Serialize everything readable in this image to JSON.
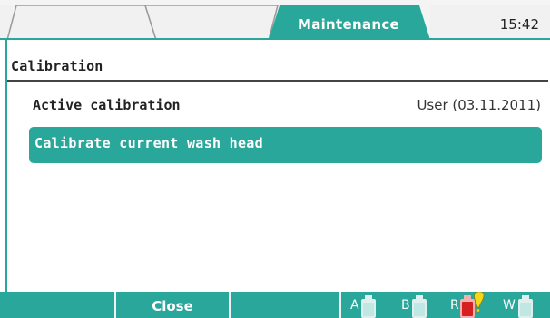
{
  "header": {
    "tabs": [
      {
        "label": ""
      },
      {
        "label": ""
      },
      {
        "label": "Maintenance",
        "active": true
      }
    ],
    "time": "15:42"
  },
  "main": {
    "title": "Calibration",
    "active_calibration_label": "Active calibration",
    "active_calibration_value": "User (03.11.2011)",
    "calibrate_button_label": "Calibrate current wash head"
  },
  "footer": {
    "softkeys": [
      "",
      "Close",
      ""
    ],
    "bottles": [
      {
        "letter": "A",
        "color": "#bfe7e3",
        "state": "ok"
      },
      {
        "letter": "B",
        "color": "#bfe7e3",
        "state": "ok"
      },
      {
        "letter": "R",
        "color": "#d62020",
        "state": "warning"
      },
      {
        "letter": "W",
        "color": "#bfe7e3",
        "state": "ok"
      }
    ]
  },
  "colors": {
    "accent": "#2aa79b",
    "inactive_tab": "#f1f1f1",
    "warning": "#f2d81a",
    "alert": "#d62020"
  }
}
